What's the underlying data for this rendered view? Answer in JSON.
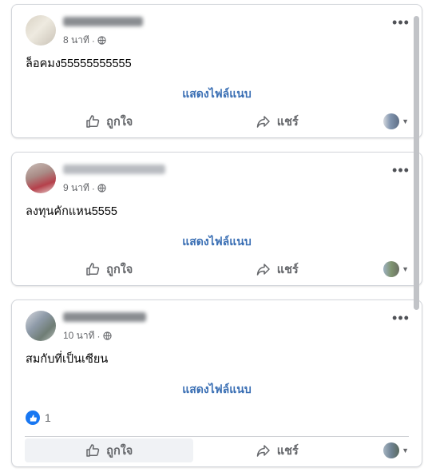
{
  "posts": [
    {
      "name": "S   t M   j",
      "time": "8 นาที",
      "separator": "·",
      "text": "ล็อคมง55555555555",
      "see_translation": "แสดงไฟล์แนบ",
      "like_label": "ถูกใจ",
      "share_label": "แชร์",
      "reaction_count": ""
    },
    {
      "name": "",
      "time": "9 นาที",
      "separator": "·",
      "text": "ลงทุนคักแหน5555",
      "see_translation": "แสดงไฟล์แนบ",
      "like_label": "ถูกใจ",
      "share_label": "แชร์",
      "reaction_count": ""
    },
    {
      "name": "",
      "time": "10 นาที",
      "separator": "·",
      "text": "สมกับที่เป็นเซียน",
      "see_translation": "แสดงไฟล์แนบ",
      "like_label": "ถูกใจ",
      "share_label": "แชร์",
      "reaction_count": "1"
    }
  ],
  "icons": {
    "more": "more-horizontal-icon",
    "globe": "globe-icon",
    "like": "thumbs-up-icon",
    "share": "share-arrow-icon",
    "reaction": "like-reaction-icon"
  },
  "colors": {
    "link": "#3a6fb4",
    "muted": "#65676b",
    "like_blue": "#1877f2"
  }
}
